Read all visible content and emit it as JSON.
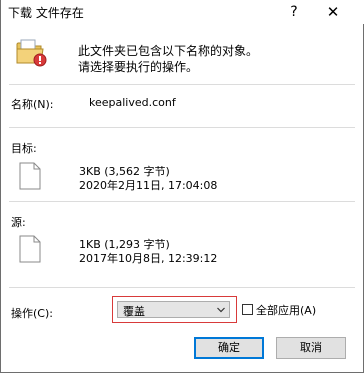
{
  "dialog": {
    "title": "下载 文件存在",
    "help_label": "?",
    "close_label": "✕"
  },
  "message": {
    "line1": "此文件夹已包含以下名称的对象。",
    "line2": "请选择要执行的操作。"
  },
  "name": {
    "label": "名称(N):",
    "value": "keepalived.conf"
  },
  "target": {
    "label": "目标:",
    "size": "3KB (3,562 字节)",
    "modified": "2020年2月11日, 17:04:08"
  },
  "source": {
    "label": "源:",
    "size": "1KB (1,293 字节)",
    "modified": "2017年10月8日, 12:39:12"
  },
  "operation": {
    "label": "操作(C):",
    "selected": "覆盖",
    "apply_all_label": "全部应用(A)",
    "apply_all_checked": false
  },
  "buttons": {
    "ok": "确定",
    "cancel": "取消"
  },
  "colors": {
    "highlight_border": "#d83a3a",
    "default_button_border": "#0078d7"
  },
  "icons": {
    "folder": "folder-warning-icon",
    "file": "file-icon"
  }
}
